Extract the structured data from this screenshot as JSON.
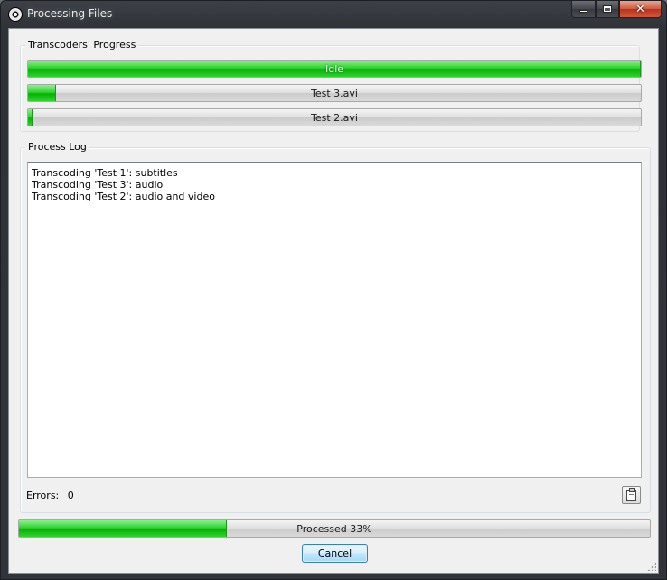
{
  "window": {
    "title": "Processing Files",
    "icon": "gear-film-icon",
    "caption_buttons": {
      "minimize": "minimize-icon",
      "maximize": "maximize-icon",
      "close": "✕"
    }
  },
  "transcoders": {
    "group_title": "Transcoders' Progress",
    "bars": [
      {
        "label": "Idle",
        "progress": 1.0
      },
      {
        "label": "Test 3.avi",
        "progress": 0.045
      },
      {
        "label": "Test 2.avi",
        "progress": 0.007
      }
    ]
  },
  "log": {
    "group_title": "Process Log",
    "lines": [
      "Transcoding 'Test 1': subtitles",
      "Transcoding 'Test 3': audio",
      "Transcoding 'Test 2': audio and video"
    ],
    "errors_label": "Errors:",
    "errors_value": "0",
    "copy_icon": "clipboard-icon"
  },
  "overall": {
    "label": "Processed 33%",
    "progress": 0.33
  },
  "buttons": {
    "cancel": "Cancel"
  },
  "colors": {
    "progress_green": "#06b006",
    "title_bar": "#2f3338",
    "client_bg": "#f0f0f0"
  }
}
